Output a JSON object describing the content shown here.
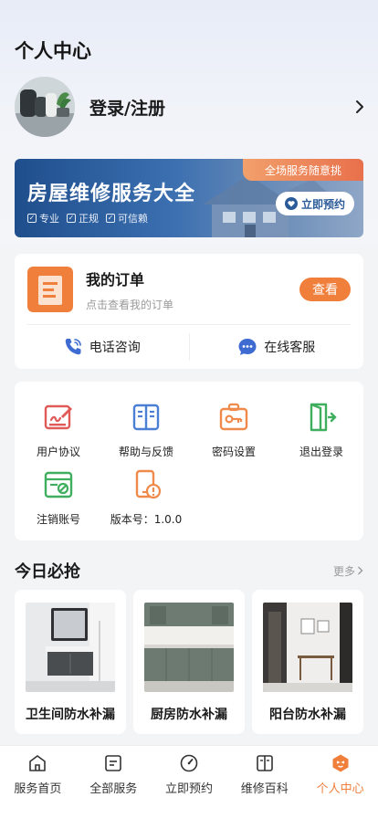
{
  "header": {
    "title": "个人中心"
  },
  "profile": {
    "login_label": "登录/注册"
  },
  "banner": {
    "title": "房屋维修服务大全",
    "ribbon": "全场服务随意挑",
    "tags": [
      "专业",
      "正规",
      "可信赖"
    ],
    "button": "立即预约"
  },
  "orders": {
    "title": "我的订单",
    "subtitle": "点击查看我的订单",
    "view_button": "查看",
    "actions": [
      "电话咨询",
      "在线客服"
    ]
  },
  "tools": [
    {
      "label": "用户协议",
      "icon": "pen-agreement-icon",
      "color": "#e05a57"
    },
    {
      "label": "帮助与反馈",
      "icon": "book-help-icon",
      "color": "#4a7fd6"
    },
    {
      "label": "密码设置",
      "icon": "key-case-icon",
      "color": "#f08a4b"
    },
    {
      "label": "退出登录",
      "icon": "exit-door-icon",
      "color": "#3fae5e"
    },
    {
      "label": "注销账号",
      "icon": "cancel-account-icon",
      "color": "#3fae5e"
    },
    {
      "label": "版本号：1.0.0",
      "icon": "phone-version-icon",
      "color": "#f08a4b"
    }
  ],
  "today": {
    "title": "今日必抢",
    "more": "更多",
    "products": [
      "卫生间防水补漏",
      "厨房防水补漏",
      "阳台防水补漏"
    ]
  },
  "tabbar": {
    "active_color": "#f07f3c",
    "tabs": [
      "服务首页",
      "全部服务",
      "立即预约",
      "维修百科",
      "个人中心"
    ]
  }
}
